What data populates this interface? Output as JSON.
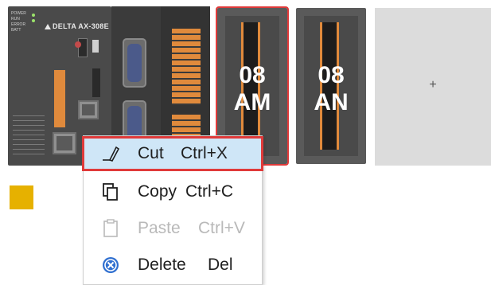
{
  "hardware": {
    "cpu": {
      "brand": "DELTA AX-308E",
      "status_labels": [
        "POWER",
        "RUN",
        "ERROR",
        "BATT",
        "LED",
        "LED"
      ]
    },
    "modules": [
      {
        "code_top": "08",
        "code_bottom": "AM",
        "selected": true
      },
      {
        "code_top": "08",
        "code_bottom": "AN",
        "selected": false
      }
    ],
    "empty_slot": {
      "symbol": "+"
    }
  },
  "context_menu": {
    "items": [
      {
        "icon": "cut-icon",
        "label": "Cut",
        "shortcut": "Ctrl+X",
        "state": "highlighted"
      },
      {
        "icon": "copy-icon",
        "label": "Copy",
        "shortcut": "Ctrl+C",
        "state": "enabled"
      },
      {
        "icon": "paste-icon",
        "label": "Paste",
        "shortcut": "Ctrl+V",
        "state": "disabled"
      },
      {
        "icon": "delete-icon",
        "label": "Delete",
        "shortcut": "Del",
        "state": "enabled"
      }
    ]
  },
  "colors": {
    "highlight_bg": "#cfe6f7",
    "highlight_border": "#e03a3a",
    "terminal_orange": "#e08a3c",
    "marker_yellow": "#e6b100"
  }
}
